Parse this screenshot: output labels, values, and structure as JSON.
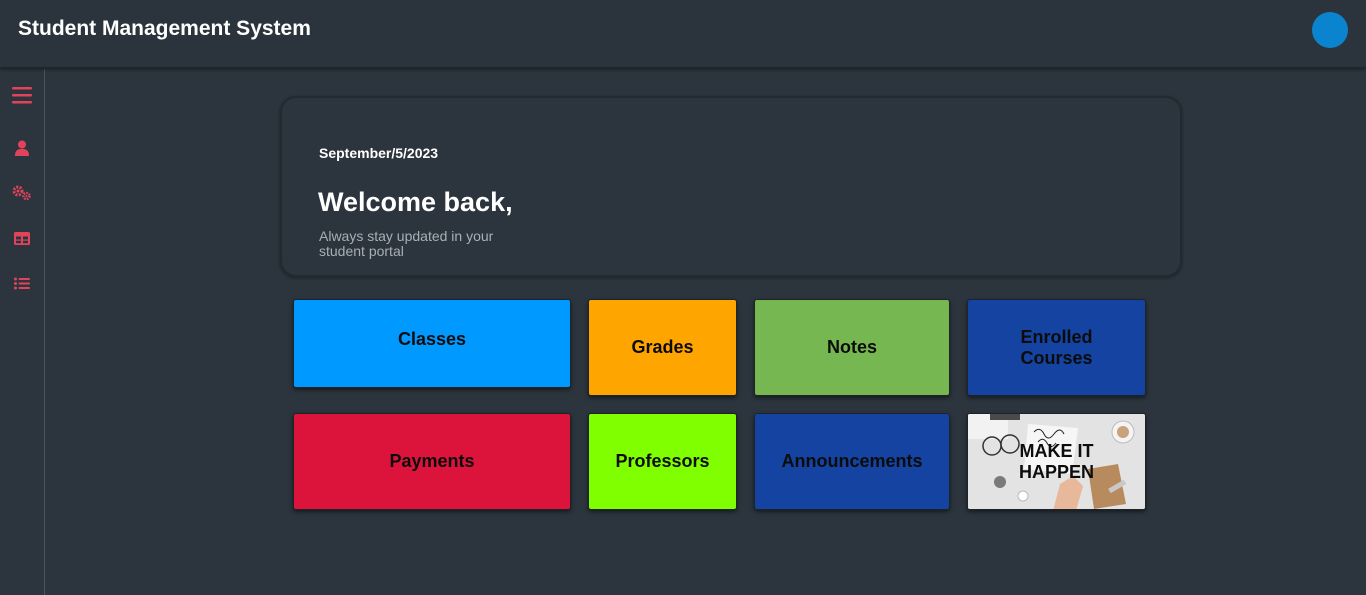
{
  "app": {
    "title": "Student Management System"
  },
  "sidebar": {
    "items": [
      {
        "icon": "menu-icon",
        "label": "Menu"
      },
      {
        "icon": "user-icon",
        "label": "Profile"
      },
      {
        "icon": "gears-icon",
        "label": "Settings"
      },
      {
        "icon": "table-icon",
        "label": "Table"
      },
      {
        "icon": "list-icon",
        "label": "List"
      }
    ],
    "icon_color": "#e0435a"
  },
  "hero": {
    "date": "September/5/2023",
    "title": "Welcome back,",
    "subtitle": "Always stay updated in your student portal"
  },
  "tiles": [
    {
      "label": "Classes",
      "color": "#0099ff"
    },
    {
      "label": "Grades",
      "color": "#ffa500"
    },
    {
      "label": "Notes",
      "color": "#77b752"
    },
    {
      "label": "Enrolled Courses",
      "color": "#1443a2"
    },
    {
      "label": "Payments",
      "color": "#dc143c"
    },
    {
      "label": "Professors",
      "color": "#80ff00"
    },
    {
      "label": "Announcements",
      "color": "#1443a2"
    },
    {
      "label": "MAKE IT HAPPEN",
      "color": "#d9d9d9"
    }
  ],
  "colors": {
    "background": "#2c353d",
    "avatar": "#0b84d0"
  }
}
